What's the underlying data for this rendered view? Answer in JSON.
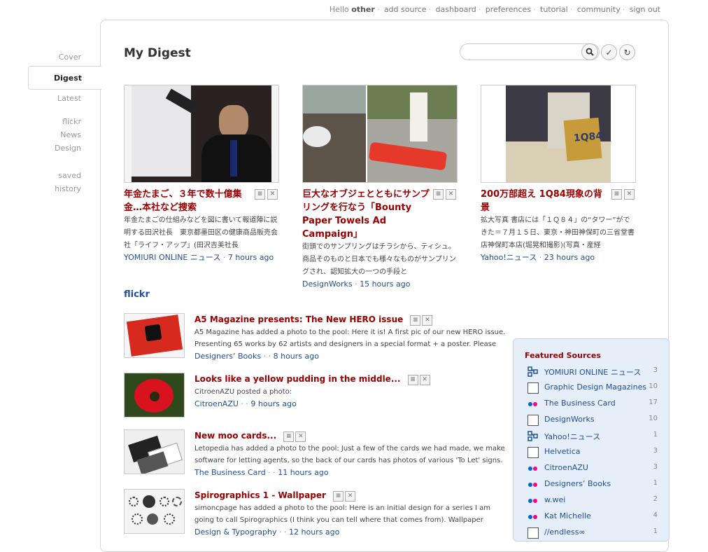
{
  "topnav": {
    "hello": "Hello",
    "user": "other",
    "links": [
      "add source",
      "dashboard",
      "preferences",
      "tutorial",
      "community",
      "sign out"
    ]
  },
  "leftnav": {
    "cover": "Cover",
    "digest": "Digest",
    "latest": "Latest",
    "groups": [
      "flickr",
      "News",
      "Design"
    ],
    "saved": "saved",
    "history": "history"
  },
  "page_title": "My Digest",
  "search": {
    "placeholder": "",
    "value": ""
  },
  "cards": [
    {
      "headline": "年金たまご、３年で数十億集金…本社など捜索",
      "snippet": "年金たまごの仕組みなどを図に書いて報道陣に説明する田沢社長　東京都墨田区の健康商品販売会社「ライフ・アップ」(田沢吉美社長",
      "source": "YOMIURI ONLINE ニュース",
      "time": "7 hours ago"
    },
    {
      "headline": "巨大なオブジェとともにサンプリングを行なう「Bounty Paper Towels Ad Campaign」",
      "snippet": "街頭でのサンプリングはチラシから、ティシュ。商品そのものと日本でも様々なものがサンプリングされ、認知拡大の一つの手段と",
      "source": "DesignWorks",
      "time": "15 hours ago"
    },
    {
      "headline": "200万部超え 1Q84現象の背景",
      "snippet": "拡大写真 書店には「１Ｑ８４」の“タワー”ができた＝７月１５日、東京・神田神保町の三省堂書店神保町本店(堀晃和撮影)(写真・産経",
      "source": "Yahoo!ニュース",
      "time": "23 hours ago"
    }
  ],
  "section_title": "flickr",
  "flickr_items": [
    {
      "title": "A5 Magazine presents: The New HERO issue",
      "snippet": "A5 Magazine has added a photo to the pool: Here it is! A first pic of our new HERO issue. Presenting 65 works by 62 artists and designers in a special format + a poster. Please",
      "source": "Designers’ Books",
      "time": "8 hours ago"
    },
    {
      "title": "Looks like a yellow pudding in the middle...",
      "snippet": "CitroenAZU posted a photo:",
      "source": "CitroenAZU",
      "time": "9 hours ago"
    },
    {
      "title": "New moo cards...",
      "snippet": "Letopedia has added a photo to the pool: Just a few of the cards we had made, we make software for letting agents, so the back of our cards has photos of various 'To Let' signs.",
      "source": "The Business Card",
      "time": "11 hours ago"
    },
    {
      "title": "Spirographics 1 - Wallpaper",
      "snippet": "simoncpage has added a photo to the pool: Here is an initial design for a series I am going to call Spirographics (I think you can tell where that comes from). Wallpaper download:",
      "source": "Design & Typography",
      "time": "12 hours ago"
    }
  ],
  "featured": {
    "title": "Featured Sources",
    "sources": [
      {
        "name": "YOMIURI ONLINE ニュース",
        "count": "3",
        "icon": "feed-icon"
      },
      {
        "name": "Graphic Design Magazines",
        "count": "10",
        "icon": "box-icon"
      },
      {
        "name": "The Business Card",
        "count": "17",
        "icon": "flickr-icon"
      },
      {
        "name": "DesignWorks",
        "count": "10",
        "icon": "box-icon"
      },
      {
        "name": "Yahoo!ニュース",
        "count": "1",
        "icon": "feed-icon"
      },
      {
        "name": "Helvetica",
        "count": "3",
        "icon": "box-icon"
      },
      {
        "name": "CitroenAZU",
        "count": "3",
        "icon": "flickr-icon"
      },
      {
        "name": "Designers’ Books",
        "count": "1",
        "icon": "flickr-icon"
      },
      {
        "name": "w.wei",
        "count": "2",
        "icon": "flickr-icon"
      },
      {
        "name": "Kat Michelle",
        "count": "4",
        "icon": "flickr-icon"
      },
      {
        "name": "//endless∞",
        "count": "1",
        "icon": "box-icon"
      }
    ]
  },
  "icons": {
    "search": "search-icon",
    "check": "check-icon",
    "refresh": "refresh-icon",
    "save": "save-icon",
    "close": "close-icon"
  },
  "colors": {
    "headline": "#990000",
    "link": "#1f4f99",
    "featured_bg": "#e6eef9"
  }
}
